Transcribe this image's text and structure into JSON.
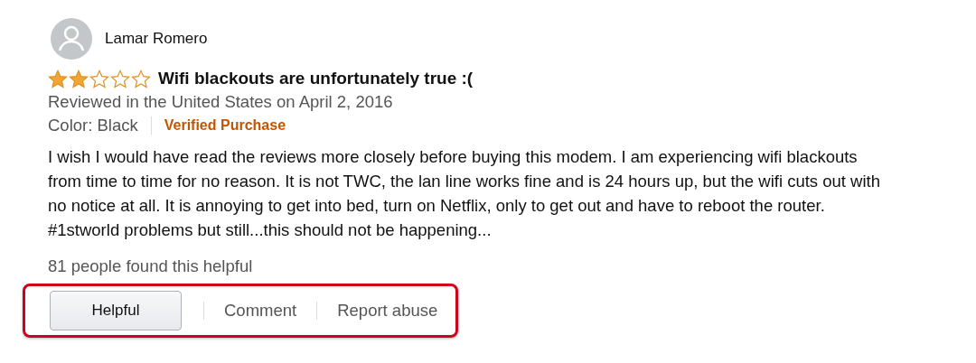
{
  "review": {
    "author": "Lamar Romero",
    "stars": 2,
    "title": "Wifi blackouts are unfortunately true :(",
    "meta": "Reviewed in the United States on April 2, 2016",
    "variant": "Color: Black",
    "badge": "Verified Purchase",
    "body": "I wish I would have read the reviews more closely before buying this modem. I am experiencing wifi blackouts from time to time for no reason. It is not TWC, the lan line works fine and is 24 hours up, but the wifi cuts out with no notice at all. It is annoying to get into bed, turn on Netflix, only to get out and have to reboot the router. #1stworld problems but still...this should not be happening...",
    "helpful_count": "81 people found this helpful"
  },
  "actions": {
    "highlighted": true,
    "button": "Helpful",
    "links": [
      "Comment",
      "Report abuse"
    ]
  }
}
